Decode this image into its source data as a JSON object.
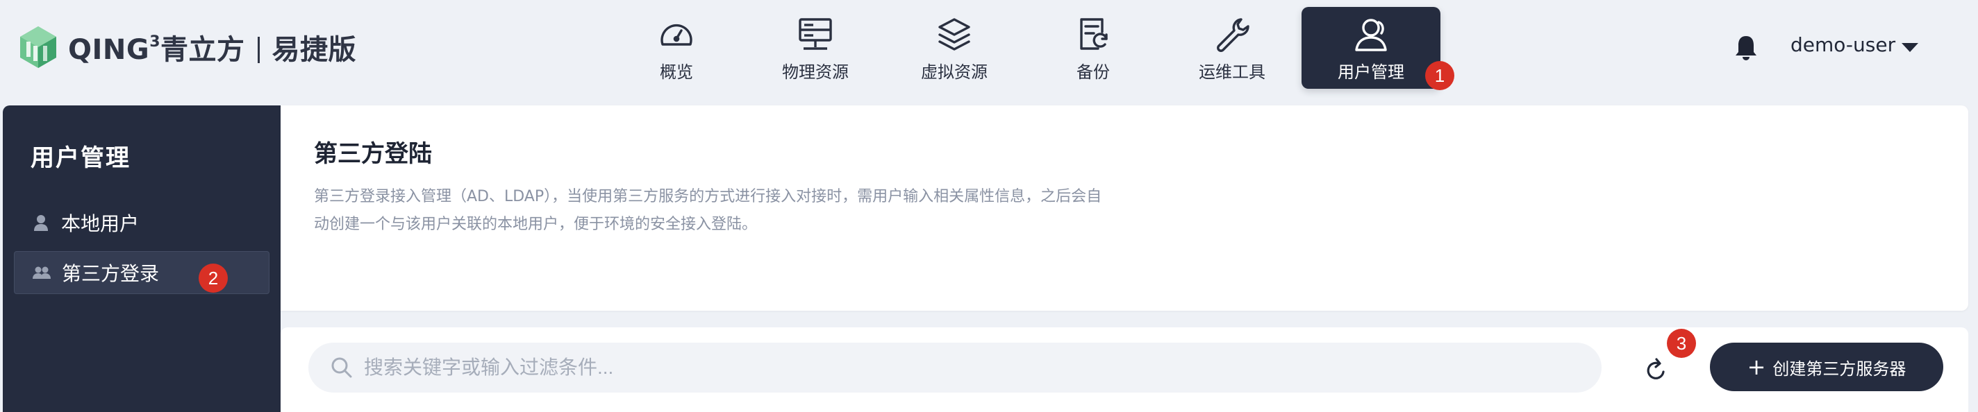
{
  "brand": {
    "name": "QING",
    "superscript": "3",
    "chinese_name": "青立方",
    "edition": "易捷版",
    "colors": {
      "logo_green": "#3fa36c",
      "logo_green_light": "#6cc48e"
    }
  },
  "nav": {
    "items": [
      {
        "label": "概览",
        "icon": "dashboard-gauge-icon",
        "active": false
      },
      {
        "label": "物理资源",
        "icon": "server-icon",
        "active": false
      },
      {
        "label": "虚拟资源",
        "icon": "layers-icon",
        "active": false
      },
      {
        "label": "备份",
        "icon": "backup-document-icon",
        "active": false
      },
      {
        "label": "运维工具",
        "icon": "wrench-icon",
        "active": false
      },
      {
        "label": "用户管理",
        "icon": "user-icon",
        "active": true
      }
    ]
  },
  "header": {
    "notification_icon": "bell-icon",
    "username": "demo-user",
    "menu_icon": "caret-down-icon"
  },
  "sidebar": {
    "title": "用户管理",
    "items": [
      {
        "label": "本地用户",
        "icon": "single-user-icon",
        "active": false
      },
      {
        "label": "第三方登录",
        "icon": "group-users-icon",
        "active": true
      }
    ]
  },
  "main": {
    "title": "第三方登陆",
    "description": "第三方登录接入管理（AD、LDAP），当使用第三方服务的方式进行接入对接时，需用户输入相关属性信息，之后会自动创建一个与该用户关联的本地用户，便于环境的安全接入登陆。",
    "search": {
      "placeholder": "搜索关键字或输入过滤条件...",
      "value": ""
    },
    "create_button": "创建第三方服务器"
  },
  "annotations": {
    "badges": [
      "1",
      "2",
      "3"
    ],
    "color": "#d93025"
  },
  "theme": {
    "dark": "#252c3f",
    "background": "#eef1f6",
    "muted_text": "#8a92a3"
  }
}
